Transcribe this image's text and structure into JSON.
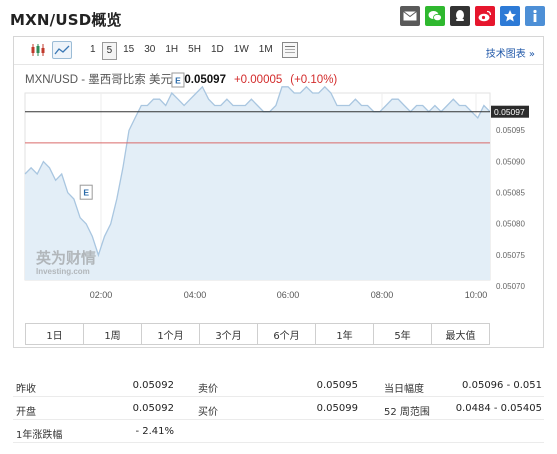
{
  "page": {
    "title": "MXN/USD概览"
  },
  "share_icons": [
    "mail-icon",
    "wechat-icon",
    "qq-icon",
    "weibo-icon",
    "favorite-icon",
    "info-icon"
  ],
  "toolbar": {
    "periods": [
      "1",
      "5",
      "15",
      "30",
      "1H",
      "5H",
      "1D",
      "1W",
      "1M"
    ],
    "active_period": "5",
    "tech_link": "技术图表 »"
  },
  "quote": {
    "name": "MXN/USD - 墨西哥比索 美元",
    "price": "0.05097",
    "change": "+0.00005",
    "change_pct": "(+0.10%)"
  },
  "watermark": {
    "cn": "英为财情",
    "en": "Investing.com"
  },
  "colors": {
    "line": "#a9c6e0",
    "fill": "#e3eef7",
    "ref_red": "#d96a6a",
    "ref_black": "#333333",
    "up": "#d32b2b",
    "link": "#1f57a8"
  },
  "chart_data": {
    "type": "area",
    "x_ticks": [
      "02:00",
      "04:00",
      "06:00",
      "08:00",
      "10:00"
    ],
    "y_ticks": [
      "0.05097",
      "0.05095",
      "0.05090",
      "0.05085",
      "0.05080",
      "0.05075",
      "0.05070"
    ],
    "ylim": [
      0.0507,
      0.051
    ],
    "current_price_label": "0.05097",
    "current_line": 0.05097,
    "prev_close_line": 0.05092,
    "event_markers": [
      "E",
      "E"
    ],
    "series": [
      {
        "values": [
          0.05087,
          0.05088,
          0.05087,
          0.05089,
          0.05088,
          0.05086,
          0.05087,
          0.05084,
          0.05083,
          0.0508,
          0.05079,
          0.05077,
          0.05074,
          0.05077,
          0.05079,
          0.05083,
          0.05088,
          0.05094,
          0.05096,
          0.05098,
          0.05098,
          0.05099,
          0.05099,
          0.05098,
          0.051,
          0.05099,
          0.05098,
          0.05099,
          0.051,
          0.05101,
          0.05099,
          0.05098,
          0.05098,
          0.05099,
          0.05098,
          0.05098,
          0.05098,
          0.05099,
          0.05098,
          0.05097,
          0.05097,
          0.05098,
          0.05101,
          0.05101,
          0.051,
          0.051,
          0.05101,
          0.051,
          0.051,
          0.05101,
          0.051,
          0.05098,
          0.05098,
          0.05098,
          0.05099,
          0.05098,
          0.05098,
          0.05097,
          0.05097,
          0.05098,
          0.05099,
          0.05099,
          0.05098,
          0.05097,
          0.05098,
          0.05098,
          0.05097,
          0.05098,
          0.05097,
          0.05098,
          0.05099,
          0.05098,
          0.05098,
          0.05097,
          0.05096,
          0.05098,
          0.05097
        ]
      }
    ]
  },
  "ranges": [
    "1日",
    "1周",
    "1个月",
    "3个月",
    "6个月",
    "1年",
    "5年",
    "最大值"
  ],
  "stats": {
    "prev_close_label": "昨收",
    "prev_close": "0.05092",
    "open_label": "开盘",
    "open": "0.05092",
    "change_1y_label": "1年涨跌幅",
    "change_1y": "- 2.41%",
    "ask_label": "卖价",
    "ask": "0.05095",
    "bid_label": "买价",
    "bid": "0.05099",
    "day_range_label": "当日幅度",
    "day_range": "0.05096 - 0.051",
    "week52_label": "52 周范围",
    "week52": "0.0484 - 0.05405"
  }
}
